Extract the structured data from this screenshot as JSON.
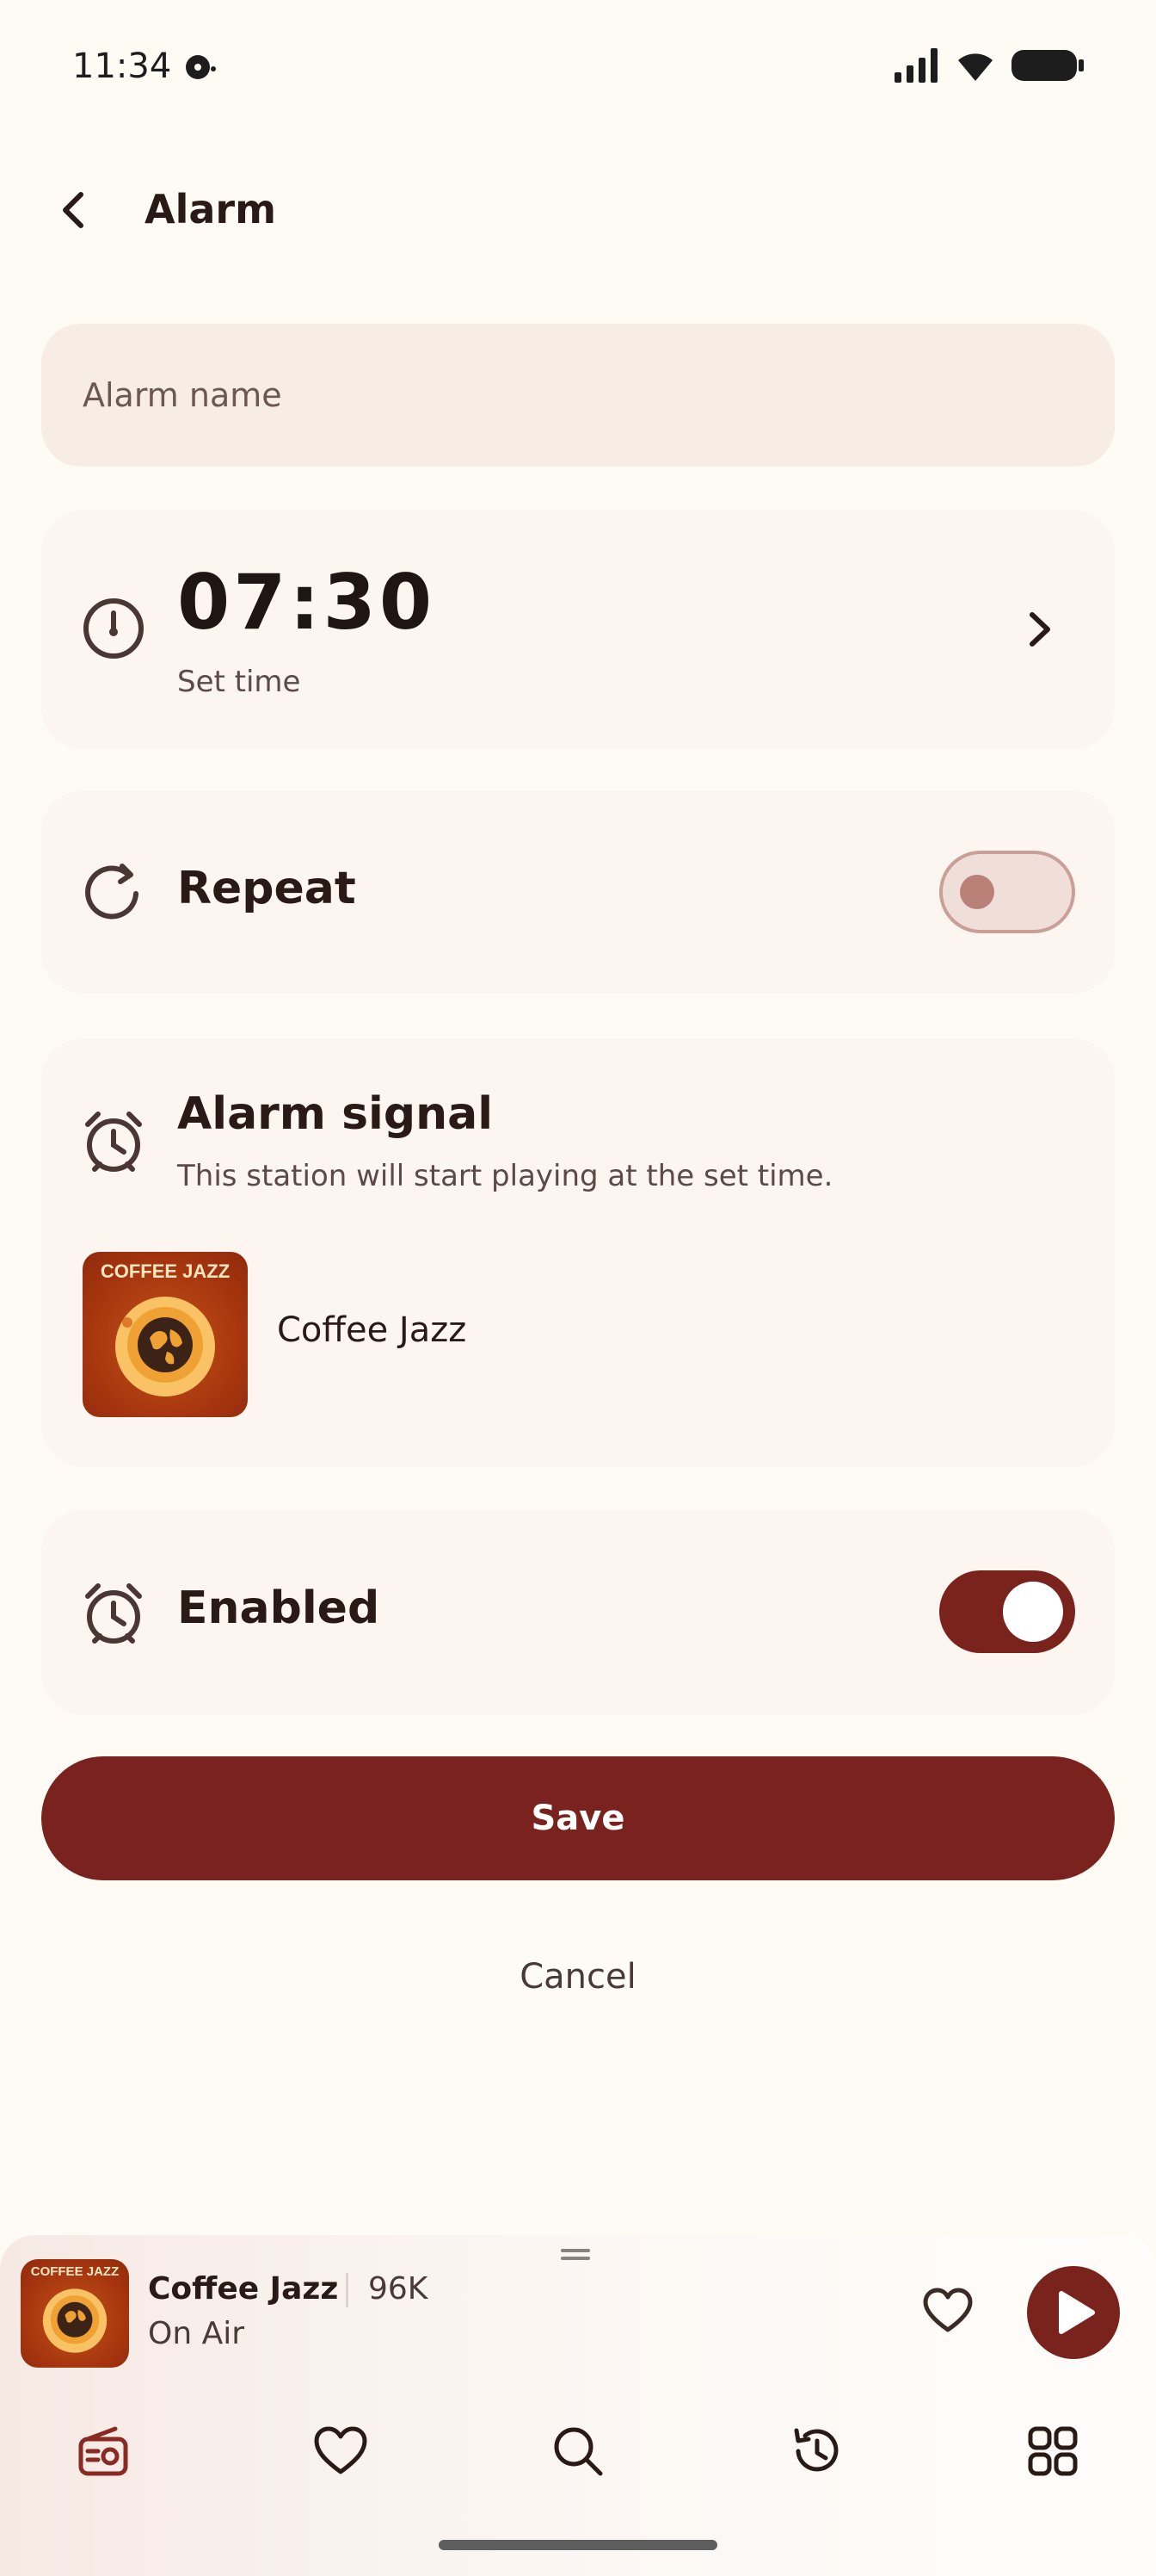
{
  "status_bar": {
    "time": "11:34"
  },
  "header": {
    "title": "Alarm"
  },
  "alarm_name": {
    "placeholder": "Alarm name",
    "value": ""
  },
  "time_card": {
    "time": "07:30",
    "subtitle": "Set time"
  },
  "repeat": {
    "label": "Repeat",
    "enabled": false
  },
  "signal": {
    "title": "Alarm signal",
    "description": "This station will start playing at the set time.",
    "station_name": "Coffee Jazz",
    "artwork_text": "COFFEE JAZZ"
  },
  "enabled_row": {
    "label": "Enabled",
    "enabled": true
  },
  "actions": {
    "save": "Save",
    "cancel": "Cancel"
  },
  "player": {
    "station": "Coffee Jazz",
    "bitrate": "96K",
    "status": "On Air",
    "artwork_text": "COFFEE JAZZ"
  },
  "bottom_nav": {
    "items": [
      "radio-icon",
      "heart-icon",
      "search-icon",
      "history-icon",
      "grid-icon"
    ]
  },
  "colors": {
    "accent": "#7a221d",
    "background": "#fefbf5",
    "card": "#fdf5ef"
  }
}
